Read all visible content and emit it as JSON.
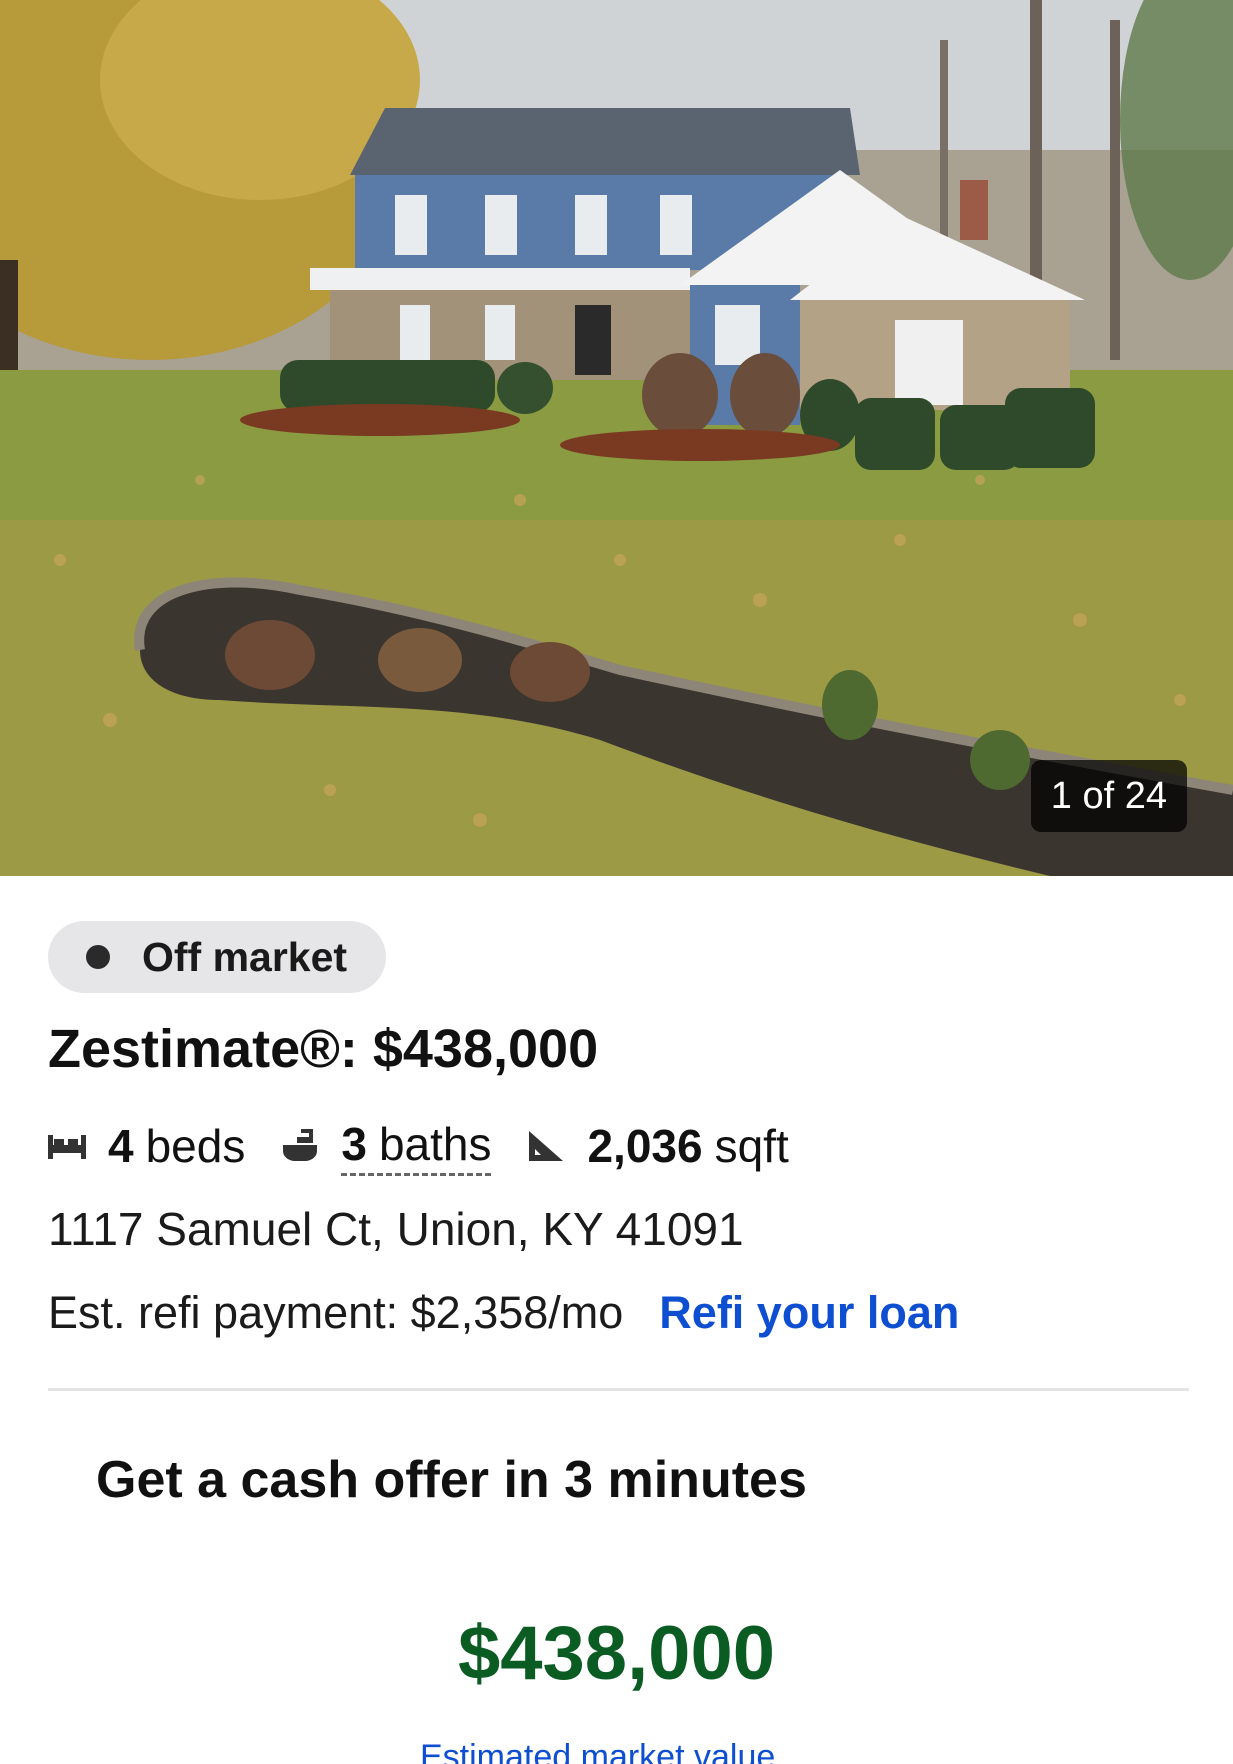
{
  "photo": {
    "counter_text": "1 of 24",
    "alt_subject": "house-exterior"
  },
  "status": {
    "label": "Off market",
    "dot_color": "#2a2a2a"
  },
  "zestimate": {
    "text": "Zestimate®: $438,000"
  },
  "facts": {
    "beds_value": "4",
    "beds_label": "beds",
    "baths_value": "3",
    "baths_label": "baths",
    "sqft_value": "2,036",
    "sqft_label": "sqft",
    "icons": [
      "bed-icon",
      "bath-icon",
      "ruler-icon"
    ]
  },
  "address": "1117 Samuel Ct, Union, KY 41091",
  "refi": {
    "text": "Est. refi payment: $2,358/mo",
    "link_label": "Refi your loan",
    "link_color": "#0d4fd0"
  },
  "cash_offer": {
    "title": "Get a cash offer in 3 minutes",
    "value": "$438,000",
    "value_color": "#0b5c22",
    "caption": "Estimated market value"
  }
}
